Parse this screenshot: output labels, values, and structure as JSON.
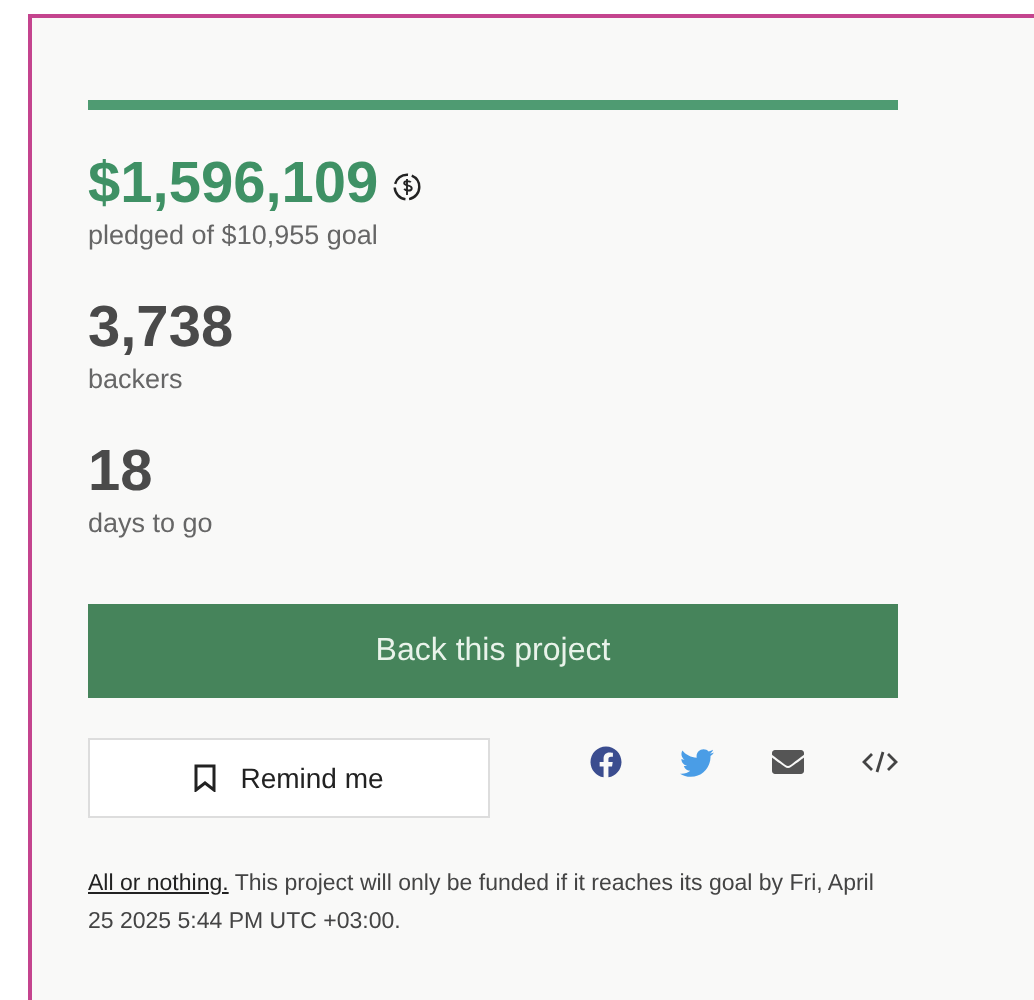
{
  "progress": {
    "level": 1
  },
  "stats": [
    {
      "kind": "money",
      "value": "$1,596,109",
      "label": "pledged of $10,955 goal"
    },
    {
      "kind": "count",
      "value": "3,738",
      "label": "backers"
    },
    {
      "kind": "count",
      "value": "18",
      "label": "days to go"
    }
  ],
  "back_button": "Back this project",
  "remind_button": "Remind me",
  "share": [
    {
      "kind": "facebook"
    },
    {
      "kind": "twitter"
    },
    {
      "kind": "email"
    },
    {
      "kind": "embed"
    }
  ],
  "footer": {
    "link": "All or nothing.",
    "text": " This project will only be funded if it reaches its goal by Fri, April 25 2025 5:44 PM UTC +03:00."
  }
}
